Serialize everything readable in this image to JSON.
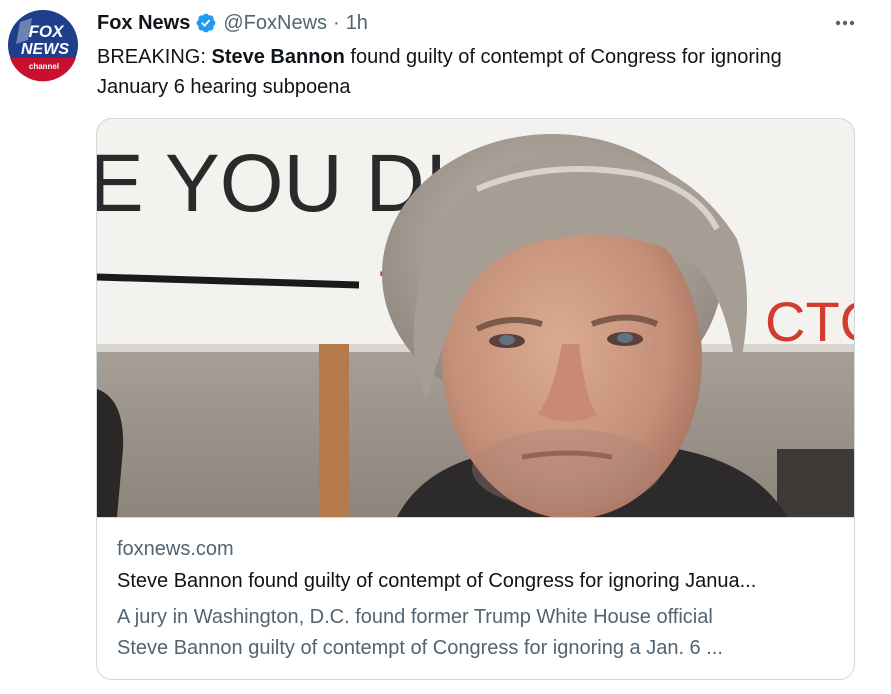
{
  "tweet": {
    "author_name": "Fox News",
    "author_handle": "@FoxNews",
    "separator": "·",
    "time": "1h",
    "text_prefix": "BREAKING: ",
    "text_bold": "Steve Bannon",
    "text_rest": " found guilty of contempt of Congress for ignoring January 6 hearing subpoena"
  },
  "avatar": {
    "logo_line1": "FOX",
    "logo_line2": "NEWS",
    "logo_line3": "channel"
  },
  "card": {
    "photo_sign_text1": "E YOU DIS",
    "photo_sign_text2": "TI",
    "photo_sign_text3": "CTC",
    "domain": "foxnews.com",
    "title": "Steve Bannon found guilty of contempt of Congress for ignoring Janua...",
    "description_line1": "A jury in Washington, D.C. found former Trump White House official",
    "description_line2": "Steve Bannon guilty of contempt of Congress for ignoring a Jan. 6 ..."
  },
  "icons": {
    "verified": "verified-badge-icon",
    "more": "more-options-icon"
  },
  "colors": {
    "verified_blue": "#1d9bf0",
    "secondary_text": "#536471",
    "primary_text": "#0f1419",
    "border": "#cfd9de",
    "fox_blue": "#1f3f8a",
    "fox_red": "#c8102e"
  }
}
